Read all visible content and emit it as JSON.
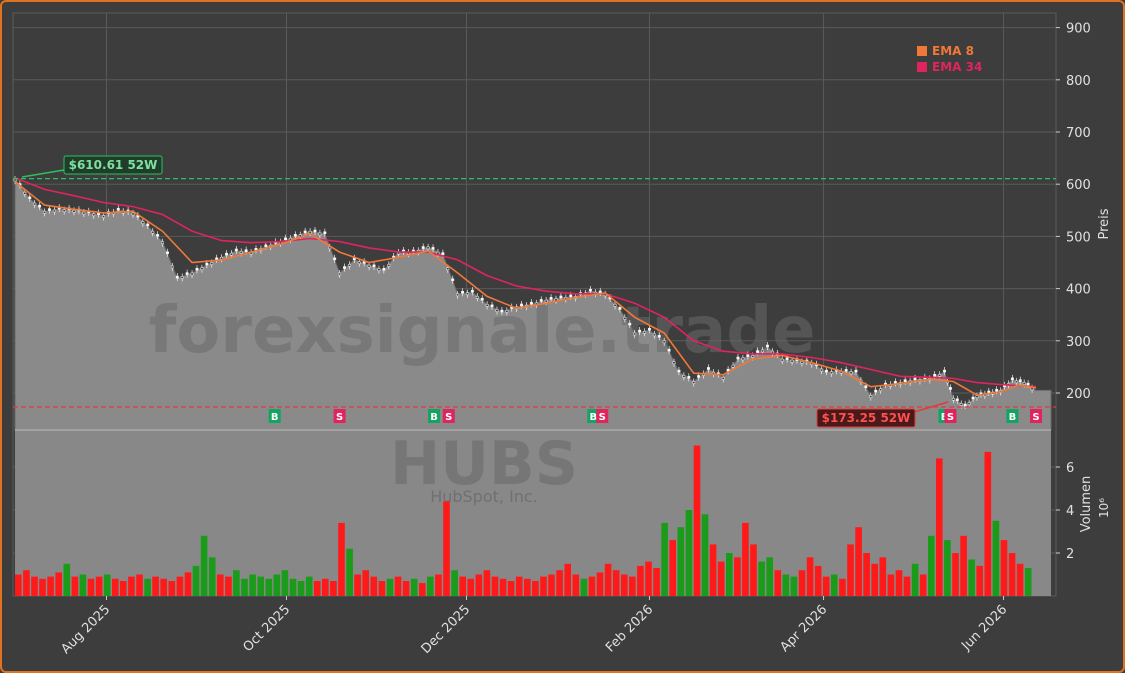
{
  "chart_data": {
    "type": "candlestick",
    "ticker_watermark": "HUBS",
    "company_watermark": "HubSpot, Inc.",
    "site_watermark": "forexsignale.trade",
    "ylabel_price": "Preis",
    "ylabel_volume": "Volumen",
    "volume_exponent": "10⁶",
    "price_yticks": [
      200,
      300,
      400,
      500,
      600,
      700,
      800,
      900
    ],
    "volume_yticks": [
      2,
      4,
      6
    ],
    "x_ticks": [
      {
        "label": "Aug 2025",
        "day": 31
      },
      {
        "label": "Oct 2025",
        "day": 92
      },
      {
        "label": "Dec 2025",
        "day": 153
      },
      {
        "label": "Feb 2026",
        "day": 215
      },
      {
        "label": "Apr 2026",
        "day": 274
      },
      {
        "label": "Jun 2026",
        "day": 335
      }
    ],
    "high_52w": {
      "label": "$610.61 52W",
      "value": 610.61
    },
    "low_52w": {
      "label": "$173.25 52W",
      "value": 173.25
    },
    "legend": [
      {
        "name": "EMA 8",
        "color": "#f07838"
      },
      {
        "name": "EMA 34",
        "color": "#e0245e"
      }
    ],
    "colors": {
      "up": "#1a9c1a",
      "down": "#ff1a1a",
      "buy": "#13a463",
      "sell": "#e0245e",
      "high_line": "#2fbf5f",
      "low_line": "#e03c3c"
    },
    "signals": [
      {
        "type": "B",
        "day": 88
      },
      {
        "type": "S",
        "day": 110
      },
      {
        "type": "B",
        "day": 142
      },
      {
        "type": "S",
        "day": 147
      },
      {
        "type": "B",
        "day": 196
      },
      {
        "type": "S",
        "day": 199
      },
      {
        "type": "B",
        "day": 315
      },
      {
        "type": "S",
        "day": 317
      },
      {
        "type": "B",
        "day": 338
      },
      {
        "type": "S",
        "day": 346
      }
    ],
    "price_series": [
      {
        "day": 0,
        "close": 610
      },
      {
        "day": 5,
        "close": 572
      },
      {
        "day": 10,
        "close": 548
      },
      {
        "day": 15,
        "close": 552
      },
      {
        "day": 20,
        "close": 550
      },
      {
        "day": 25,
        "close": 545
      },
      {
        "day": 30,
        "close": 540
      },
      {
        "day": 35,
        "close": 550
      },
      {
        "day": 40,
        "close": 545
      },
      {
        "day": 45,
        "close": 520
      },
      {
        "day": 50,
        "close": 490
      },
      {
        "day": 55,
        "close": 420
      },
      {
        "day": 60,
        "close": 430
      },
      {
        "day": 65,
        "close": 445
      },
      {
        "day": 70,
        "close": 460
      },
      {
        "day": 75,
        "close": 472
      },
      {
        "day": 80,
        "close": 470
      },
      {
        "day": 85,
        "close": 480
      },
      {
        "day": 90,
        "close": 490
      },
      {
        "day": 95,
        "close": 500
      },
      {
        "day": 100,
        "close": 510
      },
      {
        "day": 105,
        "close": 505
      },
      {
        "day": 110,
        "close": 430
      },
      {
        "day": 115,
        "close": 455
      },
      {
        "day": 120,
        "close": 445
      },
      {
        "day": 125,
        "close": 435
      },
      {
        "day": 130,
        "close": 470
      },
      {
        "day": 135,
        "close": 470
      },
      {
        "day": 140,
        "close": 480
      },
      {
        "day": 145,
        "close": 465
      },
      {
        "day": 150,
        "close": 390
      },
      {
        "day": 155,
        "close": 393
      },
      {
        "day": 160,
        "close": 370
      },
      {
        "day": 165,
        "close": 355
      },
      {
        "day": 170,
        "close": 365
      },
      {
        "day": 175,
        "close": 370
      },
      {
        "day": 180,
        "close": 378
      },
      {
        "day": 185,
        "close": 382
      },
      {
        "day": 190,
        "close": 385
      },
      {
        "day": 195,
        "close": 395
      },
      {
        "day": 200,
        "close": 390
      },
      {
        "day": 205,
        "close": 360
      },
      {
        "day": 210,
        "close": 315
      },
      {
        "day": 215,
        "close": 320
      },
      {
        "day": 220,
        "close": 300
      },
      {
        "day": 225,
        "close": 240
      },
      {
        "day": 230,
        "close": 222
      },
      {
        "day": 235,
        "close": 245
      },
      {
        "day": 240,
        "close": 230
      },
      {
        "day": 245,
        "close": 265
      },
      {
        "day": 250,
        "close": 272
      },
      {
        "day": 255,
        "close": 288
      },
      {
        "day": 260,
        "close": 265
      },
      {
        "day": 265,
        "close": 262
      },
      {
        "day": 270,
        "close": 258
      },
      {
        "day": 275,
        "close": 240
      },
      {
        "day": 280,
        "close": 242
      },
      {
        "day": 285,
        "close": 240
      },
      {
        "day": 290,
        "close": 195
      },
      {
        "day": 295,
        "close": 215
      },
      {
        "day": 300,
        "close": 220
      },
      {
        "day": 305,
        "close": 225
      },
      {
        "day": 310,
        "close": 228
      },
      {
        "day": 315,
        "close": 240
      },
      {
        "day": 318,
        "close": 190
      },
      {
        "day": 322,
        "close": 175
      },
      {
        "day": 326,
        "close": 195
      },
      {
        "day": 330,
        "close": 200
      },
      {
        "day": 334,
        "close": 205
      },
      {
        "day": 338,
        "close": 225
      },
      {
        "day": 342,
        "close": 220
      },
      {
        "day": 346,
        "close": 205
      }
    ],
    "ema8": [
      {
        "day": 0,
        "value": 605
      },
      {
        "day": 10,
        "value": 560
      },
      {
        "day": 20,
        "value": 552
      },
      {
        "day": 30,
        "value": 545
      },
      {
        "day": 40,
        "value": 548
      },
      {
        "day": 50,
        "value": 510
      },
      {
        "day": 60,
        "value": 450
      },
      {
        "day": 70,
        "value": 455
      },
      {
        "day": 80,
        "value": 470
      },
      {
        "day": 90,
        "value": 485
      },
      {
        "day": 100,
        "value": 505
      },
      {
        "day": 110,
        "value": 470
      },
      {
        "day": 120,
        "value": 450
      },
      {
        "day": 130,
        "value": 460
      },
      {
        "day": 140,
        "value": 472
      },
      {
        "day": 150,
        "value": 430
      },
      {
        "day": 160,
        "value": 385
      },
      {
        "day": 170,
        "value": 362
      },
      {
        "day": 180,
        "value": 372
      },
      {
        "day": 190,
        "value": 383
      },
      {
        "day": 200,
        "value": 392
      },
      {
        "day": 210,
        "value": 345
      },
      {
        "day": 220,
        "value": 315
      },
      {
        "day": 230,
        "value": 238
      },
      {
        "day": 240,
        "value": 235
      },
      {
        "day": 250,
        "value": 265
      },
      {
        "day": 260,
        "value": 272
      },
      {
        "day": 270,
        "value": 258
      },
      {
        "day": 280,
        "value": 242
      },
      {
        "day": 290,
        "value": 212
      },
      {
        "day": 300,
        "value": 218
      },
      {
        "day": 310,
        "value": 226
      },
      {
        "day": 318,
        "value": 222
      },
      {
        "day": 326,
        "value": 196
      },
      {
        "day": 334,
        "value": 202
      },
      {
        "day": 340,
        "value": 215
      },
      {
        "day": 346,
        "value": 210
      }
    ],
    "ema34": [
      {
        "day": 0,
        "value": 612
      },
      {
        "day": 10,
        "value": 590
      },
      {
        "day": 20,
        "value": 578
      },
      {
        "day": 30,
        "value": 565
      },
      {
        "day": 40,
        "value": 557
      },
      {
        "day": 50,
        "value": 542
      },
      {
        "day": 60,
        "value": 510
      },
      {
        "day": 70,
        "value": 492
      },
      {
        "day": 80,
        "value": 488
      },
      {
        "day": 90,
        "value": 490
      },
      {
        "day": 100,
        "value": 496
      },
      {
        "day": 110,
        "value": 490
      },
      {
        "day": 120,
        "value": 478
      },
      {
        "day": 130,
        "value": 470
      },
      {
        "day": 140,
        "value": 470
      },
      {
        "day": 150,
        "value": 455
      },
      {
        "day": 160,
        "value": 425
      },
      {
        "day": 170,
        "value": 405
      },
      {
        "day": 180,
        "value": 395
      },
      {
        "day": 190,
        "value": 390
      },
      {
        "day": 200,
        "value": 390
      },
      {
        "day": 210,
        "value": 372
      },
      {
        "day": 220,
        "value": 345
      },
      {
        "day": 230,
        "value": 300
      },
      {
        "day": 240,
        "value": 280
      },
      {
        "day": 250,
        "value": 275
      },
      {
        "day": 260,
        "value": 275
      },
      {
        "day": 270,
        "value": 268
      },
      {
        "day": 280,
        "value": 258
      },
      {
        "day": 290,
        "value": 245
      },
      {
        "day": 300,
        "value": 232
      },
      {
        "day": 310,
        "value": 230
      },
      {
        "day": 318,
        "value": 228
      },
      {
        "day": 326,
        "value": 220
      },
      {
        "day": 334,
        "value": 216
      },
      {
        "day": 340,
        "value": 214
      },
      {
        "day": 346,
        "value": 212
      }
    ],
    "volume_millions": [
      1.0,
      1.2,
      0.9,
      0.8,
      0.9,
      1.1,
      1.5,
      0.9,
      1.0,
      0.8,
      0.9,
      1.0,
      0.8,
      0.7,
      0.9,
      1.0,
      0.8,
      0.9,
      0.8,
      0.7,
      0.9,
      1.1,
      1.4,
      2.8,
      1.8,
      1.0,
      0.9,
      1.2,
      0.8,
      1.0,
      0.9,
      0.8,
      1.0,
      1.2,
      0.8,
      0.7,
      0.9,
      0.7,
      0.8,
      0.7,
      3.4,
      2.2,
      1.0,
      1.2,
      0.9,
      0.7,
      0.8,
      0.9,
      0.7,
      0.8,
      0.6,
      0.9,
      1.0,
      4.4,
      1.2,
      0.9,
      0.8,
      1.0,
      1.2,
      0.9,
      0.8,
      0.7,
      0.9,
      0.8,
      0.7,
      0.9,
      1.0,
      1.2,
      1.5,
      1.0,
      0.8,
      0.9,
      1.1,
      1.5,
      1.2,
      1.0,
      0.9,
      1.4,
      1.6,
      1.3,
      3.4,
      2.6,
      3.2,
      4.0,
      7.0,
      3.8,
      2.4,
      1.6,
      2.0,
      1.8,
      3.4,
      2.4,
      1.6,
      1.8,
      1.2,
      1.0,
      0.9,
      1.2,
      1.8,
      1.4,
      0.9,
      1.0,
      0.8,
      2.4,
      3.2,
      2.0,
      1.5,
      1.8,
      1.0,
      1.2,
      0.9,
      1.5,
      1.0,
      2.8,
      6.4,
      2.6,
      2.0,
      2.8,
      1.7,
      1.4,
      6.7,
      3.5,
      2.6,
      2.0,
      1.5,
      1.3
    ]
  }
}
